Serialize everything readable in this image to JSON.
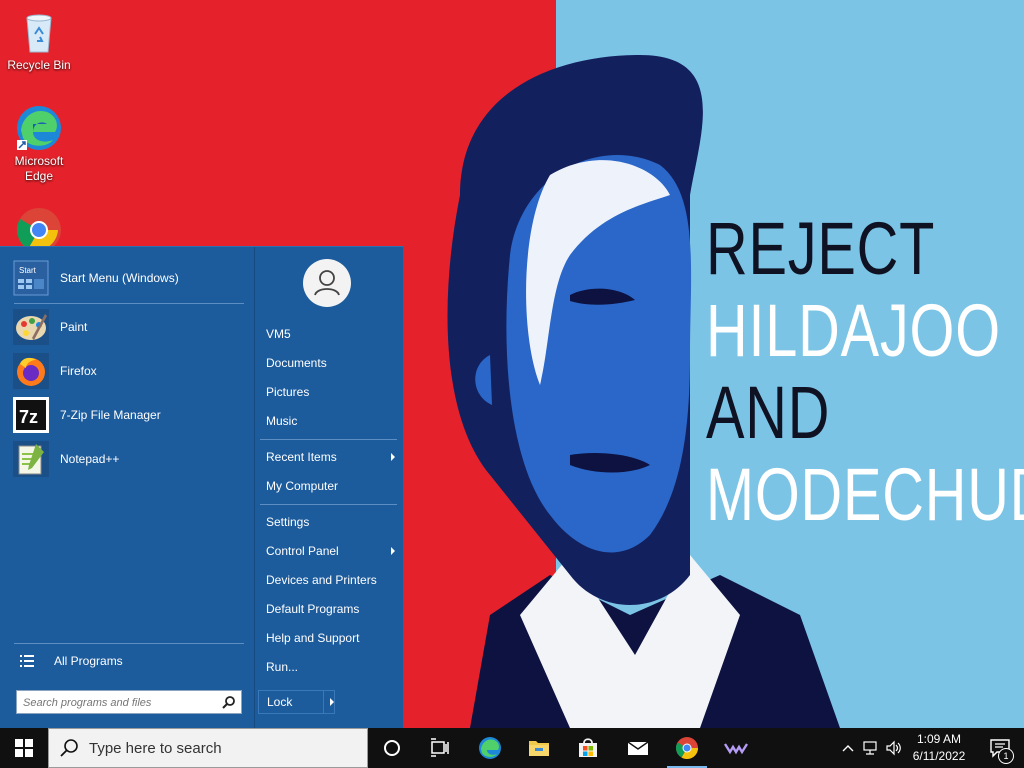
{
  "wallpaper": {
    "lines": [
      "REJECT",
      "HILDAJOO",
      "AND",
      "MODECHUD"
    ]
  },
  "desktop_icons": [
    {
      "label": "Recycle Bin",
      "icon": "recycle-bin-icon"
    },
    {
      "label": "Microsoft Edge",
      "icon": "edge-icon"
    },
    {
      "label": "",
      "icon": "chrome-icon"
    }
  ],
  "start_menu": {
    "pinned": {
      "label": "Start Menu (Windows)",
      "icon": "start-menu-icon"
    },
    "programs": [
      {
        "label": "Paint",
        "icon": "paint-icon"
      },
      {
        "label": "Firefox",
        "icon": "firefox-icon"
      },
      {
        "label": "7-Zip File Manager",
        "icon": "7zip-icon"
      },
      {
        "label": "Notepad++",
        "icon": "notepadpp-icon"
      }
    ],
    "all_programs": "All Programs",
    "search_placeholder": "Search programs and files",
    "right_items": [
      {
        "label": "VM5",
        "submenu": false
      },
      {
        "label": "Documents",
        "submenu": false
      },
      {
        "label": "Pictures",
        "submenu": false
      },
      {
        "label": "Music",
        "submenu": false
      },
      {
        "label": "Recent Items",
        "submenu": true
      },
      {
        "label": "My Computer",
        "submenu": false
      },
      {
        "label": "Settings",
        "submenu": false
      },
      {
        "label": "Control Panel",
        "submenu": true
      },
      {
        "label": "Devices and Printers",
        "submenu": false
      },
      {
        "label": "Default Programs",
        "submenu": false
      },
      {
        "label": "Help and Support",
        "submenu": false
      },
      {
        "label": "Run...",
        "submenu": false
      }
    ],
    "lock_label": "Lock"
  },
  "taskbar": {
    "search_placeholder": "Type here to search",
    "apps": [
      "cortana-icon",
      "task-view-icon",
      "edge-icon",
      "file-explorer-icon",
      "store-icon",
      "mail-icon",
      "chrome-icon",
      "app-icon"
    ],
    "time": "1:09 AM",
    "date": "6/11/2022",
    "notification_count": "1"
  },
  "colors": {
    "menu_bg": "#1c5b9c",
    "taskbar_bg": "#101010",
    "wallpaper_red": "#e5222b",
    "wallpaper_blue": "#7cc4e6"
  }
}
